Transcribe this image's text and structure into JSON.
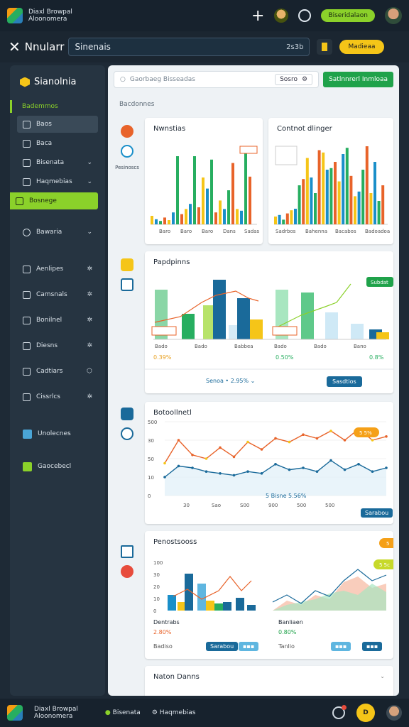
{
  "topbar": {
    "app_line1": "Diaxl Browpal",
    "app_line2": "Aloonomera",
    "status_pill": "Biseridalaon",
    "plus": "+"
  },
  "searchbar": {
    "brand": "Nnularr",
    "search_value": "Sinenais",
    "count": "2s3b",
    "cta": "Madieaa"
  },
  "sidebar": {
    "title": "Sianolnia",
    "section": "Bademmos",
    "items": [
      {
        "label": "Baos",
        "chev": false
      },
      {
        "label": "Baca",
        "chev": false
      },
      {
        "label": "Bisenata",
        "chev": true
      },
      {
        "label": "Haqmebias",
        "chev": true
      },
      {
        "label": "Bosnege",
        "chev": false
      },
      {
        "label": "Bawaria",
        "chev": true
      }
    ],
    "items2": [
      {
        "label": "Aenlipes"
      },
      {
        "label": "Camsnals"
      },
      {
        "label": "Bonilnel"
      },
      {
        "label": "Diesns"
      },
      {
        "label": "Cadtiars"
      },
      {
        "label": "Cissrlcs"
      }
    ],
    "bottom_items": [
      {
        "label": "Unolecnes"
      },
      {
        "label": "Gaocebecl"
      }
    ]
  },
  "main": {
    "search_placeholder": "Gaorbaeg Bisseadas",
    "mini_button": "Sosro",
    "green_button": "Satlnnrerl Inmloaa",
    "breadcrumb": "Bacdonnes",
    "left_label_1": "Pesinoscs",
    "cards": {
      "c1_title": "Nwnstias",
      "c2_title": "Contnot dlinger",
      "c3_title": "Papdpinns",
      "c3_footer": "Senoa",
      "c3_footer_pct": "2.95%",
      "c3_btn": "Sasdtios",
      "c4_title": "Botoollnetl",
      "c4_bottom_label": "5 Bisne 5.56%",
      "c4_btn": "Sarabou",
      "c5_title": "Penostsooss",
      "c5_left_label": "Dentrabs",
      "c5_left_pct": "2.80%",
      "c5_left_small": "Badiso",
      "c5_right_label": "Banliaen",
      "c5_right_pct": "0.80%",
      "c5_right_small": "Tanlio",
      "c5_btn1": "Sarabou",
      "c6_title": "Naton Danns"
    }
  },
  "chart_data": [
    {
      "type": "bar",
      "title": "Nwnstias",
      "categories": [
        "Baro",
        "Baro",
        "Baro",
        "Dans",
        "Sadas"
      ],
      "series": [
        {
          "values": [
            12,
            8,
            45,
            22,
            30,
            18,
            50,
            40,
            28,
            35,
            25,
            48
          ]
        }
      ],
      "colors": [
        "#f5c518",
        "#1a8fc9",
        "#27ae60",
        "#e8632a"
      ]
    },
    {
      "type": "bar",
      "title": "Contnot dlinger",
      "categories": [
        "Sadrbos",
        "Bahenna",
        "Bacabos",
        "Badoadoa"
      ],
      "colors": [
        "#f5c518",
        "#1a8fc9",
        "#27ae60",
        "#e8632a"
      ]
    },
    {
      "type": "bar",
      "title": "Papdpinns",
      "categories": [
        "Bado",
        "Bado",
        "Babbea",
        "Bado",
        "Bado",
        "Bano"
      ],
      "left_pct": "0.39%",
      "right_pct": "0.50%",
      "right_pct2": "0.8%",
      "line_tag": "Subdat"
    },
    {
      "type": "line",
      "title": "Botoollnetl",
      "y_ticks": [
        "500",
        "30",
        "50",
        "10",
        "0"
      ],
      "x_ticks": [
        "30",
        "Sao",
        "S00",
        "900",
        "500",
        "500"
      ],
      "series": [
        {
          "values": [
            35,
            60,
            44,
            40,
            52,
            42,
            58,
            50,
            62,
            58,
            66,
            62,
            70,
            60,
            72,
            60,
            64
          ]
        },
        {
          "values": [
            20,
            32,
            30,
            26,
            24,
            22,
            26,
            24,
            34,
            28,
            30,
            26,
            38,
            28,
            34,
            26,
            30
          ]
        }
      ],
      "tag": "5 5%"
    },
    {
      "type": "bar",
      "title": "Penostsooss",
      "y_ticks": [
        "100",
        "30",
        "20",
        "10",
        "0"
      ],
      "tag1": "5",
      "tag2": "5 5c"
    }
  ]
}
